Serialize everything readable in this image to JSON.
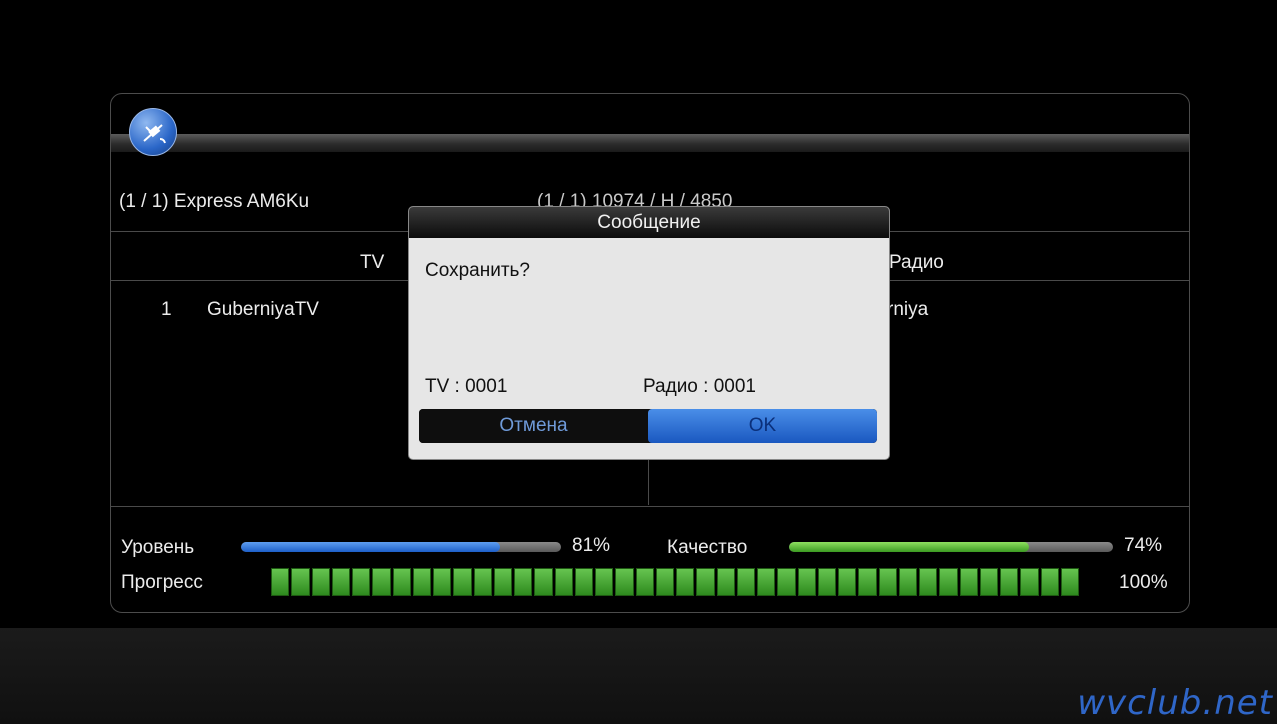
{
  "panel": {
    "satellite_info": "(1 / 1)  Express AM6Ku",
    "transponder_info": "(1 / 1)  10974 / H / 4850",
    "tv_header": "TV",
    "radio_header": "Радио",
    "tv_channels": [
      {
        "num": "1",
        "name": "GuberniyaTV"
      }
    ],
    "radio_channels": [
      {
        "name": "rniya"
      }
    ]
  },
  "signal": {
    "level_label": "Уровень",
    "level_value": "81%",
    "level_fraction": 0.81,
    "quality_label": "Качество",
    "quality_value": "74%",
    "quality_fraction": 0.74,
    "progress_label": "Прогресс",
    "progress_value": "100%",
    "progress_fraction": 1.0
  },
  "dialog": {
    "title": "Сообщение",
    "question": "Сохранить?",
    "tv_count_label": "TV  :  0001",
    "radio_count_label": "Радио  :  0001",
    "cancel_label": "Отмена",
    "ok_label": "OK"
  },
  "watermark": "wvclub.net",
  "colors": {
    "level_bar": "#2a6fd6",
    "quality_bar": "#5cc23a",
    "progress_bar": "#4caf38",
    "ok_highlight": "#2a6fd6"
  }
}
